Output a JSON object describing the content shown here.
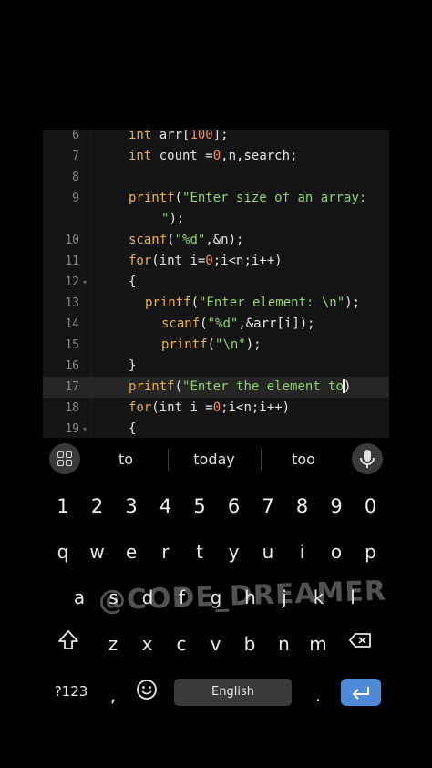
{
  "editor": {
    "lines": [
      {
        "num": "6",
        "indent": 0,
        "tokens": [
          [
            "k",
            "int "
          ],
          [
            "t",
            "arr["
          ],
          [
            "n",
            "100"
          ],
          [
            "t",
            "];"
          ]
        ]
      },
      {
        "num": "7",
        "indent": 0,
        "tokens": [
          [
            "k",
            "int "
          ],
          [
            "t",
            "count ="
          ],
          [
            "n",
            "0"
          ],
          [
            "t",
            ",n,search;"
          ]
        ]
      },
      {
        "num": "8",
        "indent": 0,
        "tokens": []
      },
      {
        "num": "9",
        "indent": 0,
        "tokens": [
          [
            "f",
            "printf"
          ],
          [
            "t",
            "("
          ],
          [
            "s",
            "\"Enter size of an array:"
          ]
        ]
      },
      {
        "num": "",
        "indent": 2,
        "tokens": [
          [
            "s",
            "\""
          ],
          [
            "t",
            ");"
          ]
        ]
      },
      {
        "num": "10",
        "indent": 0,
        "tokens": [
          [
            "f",
            "scanf"
          ],
          [
            "t",
            "("
          ],
          [
            "s",
            "\"%d\""
          ],
          [
            "t",
            ",&n);"
          ]
        ]
      },
      {
        "num": "11",
        "indent": 0,
        "tokens": [
          [
            "k",
            "for"
          ],
          [
            "t",
            "(int i="
          ],
          [
            "n",
            "0"
          ],
          [
            "t",
            ";i<n;i++)"
          ]
        ]
      },
      {
        "num": "12",
        "fold": "▾",
        "indent": 0,
        "tokens": [
          [
            "t",
            "{"
          ]
        ]
      },
      {
        "num": "13",
        "indent": 1,
        "tokens": [
          [
            "f",
            "printf"
          ],
          [
            "t",
            "("
          ],
          [
            "s",
            "\"Enter element: \\n\""
          ],
          [
            "t",
            ");"
          ]
        ]
      },
      {
        "num": "14",
        "indent": 2,
        "tokens": [
          [
            "f",
            "scanf"
          ],
          [
            "t",
            "("
          ],
          [
            "s",
            "\"%d\""
          ],
          [
            "t",
            ",&arr[i]);"
          ]
        ]
      },
      {
        "num": "15",
        "indent": 2,
        "tokens": [
          [
            "f",
            "printf"
          ],
          [
            "t",
            "("
          ],
          [
            "s",
            "\"\\n\""
          ],
          [
            "t",
            ");"
          ]
        ]
      },
      {
        "num": "16",
        "indent": 0,
        "tokens": [
          [
            "t",
            "}"
          ]
        ]
      },
      {
        "num": "17",
        "active": true,
        "indent": 0,
        "tokens": [
          [
            "f",
            "printf"
          ],
          [
            "t",
            "("
          ],
          [
            "s",
            "\"Enter the element to"
          ],
          [
            "c",
            ""
          ],
          [
            "t",
            ")"
          ]
        ]
      },
      {
        "num": "18",
        "indent": 0,
        "tokens": [
          [
            "k",
            "for"
          ],
          [
            "t",
            "(int i ="
          ],
          [
            "n",
            "0"
          ],
          [
            "t",
            ";i<n;i++)"
          ]
        ]
      },
      {
        "num": "19",
        "fold": "▾",
        "indent": 0,
        "tokens": [
          [
            "t",
            "{"
          ]
        ]
      }
    ]
  },
  "keyboard": {
    "suggestions": [
      "to",
      "today",
      "too"
    ],
    "number_row": [
      "1",
      "2",
      "3",
      "4",
      "5",
      "6",
      "7",
      "8",
      "9",
      "0"
    ],
    "row1": [
      "q",
      "w",
      "e",
      "r",
      "t",
      "y",
      "u",
      "i",
      "o",
      "p"
    ],
    "row2": [
      "a",
      "s",
      "d",
      "f",
      "g",
      "h",
      "j",
      "k",
      "l"
    ],
    "row3": [
      "z",
      "x",
      "c",
      "v",
      "b",
      "n",
      "m"
    ],
    "symbols_key": "?123",
    "comma_key": ",",
    "period_key": ".",
    "space_label": "English",
    "watermark": "@CODE_DREAMER"
  },
  "colors": {
    "keyword": "#e8b34a",
    "string": "#8fd36b",
    "number": "#ff8a5c",
    "enter_key": "#4f8ad8"
  }
}
